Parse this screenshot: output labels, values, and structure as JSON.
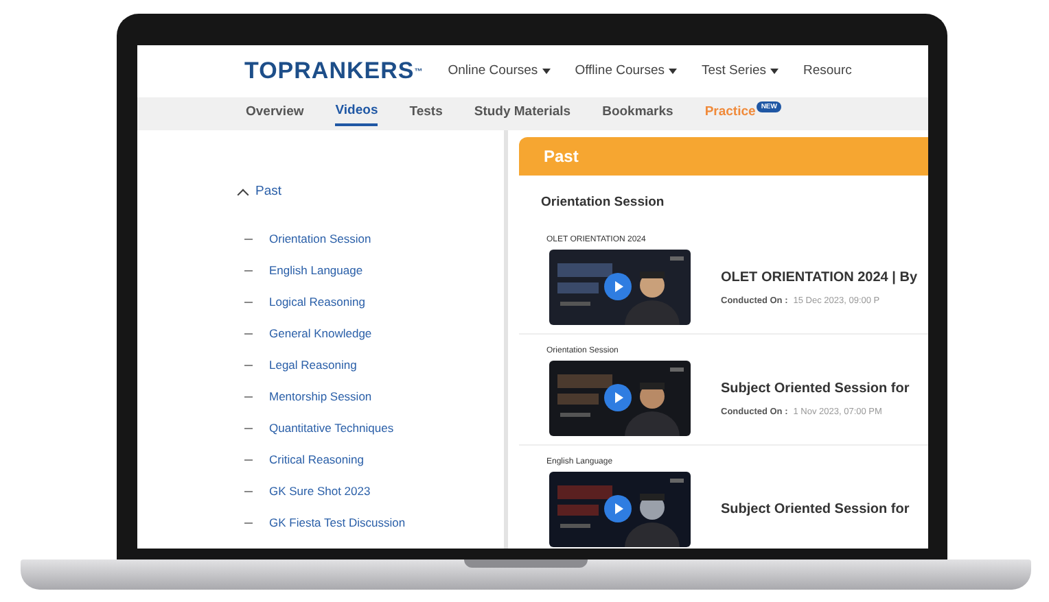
{
  "logo": {
    "text": "TOPRANKERS",
    "mark": "™"
  },
  "top_nav": [
    {
      "label": "Online Courses",
      "dropdown": true
    },
    {
      "label": "Offline Courses",
      "dropdown": true
    },
    {
      "label": "Test Series",
      "dropdown": true
    },
    {
      "label": "Resourc",
      "dropdown": false
    }
  ],
  "tabs": [
    {
      "label": "Overview",
      "selected": false
    },
    {
      "label": "Videos",
      "selected": true
    },
    {
      "label": "Tests",
      "selected": false
    },
    {
      "label": "Study Materials",
      "selected": false
    },
    {
      "label": "Bookmarks",
      "selected": false
    },
    {
      "label": "Practice",
      "selected": false,
      "badge": "NEW"
    }
  ],
  "sidebar": {
    "group": "Past",
    "expanded": true,
    "items": [
      "Orientation Session",
      "English Language",
      "Logical Reasoning",
      "General Knowledge",
      "Legal Reasoning",
      "Mentorship Session",
      "Quantitative Techniques",
      "Critical Reasoning",
      "GK Sure Shot 2023",
      "GK Fiesta Test Discussion"
    ]
  },
  "main": {
    "header": "Past",
    "section": "Orientation Session",
    "videos": [
      {
        "label": "OLET ORIENTATION 2024",
        "title": "OLET ORIENTATION 2024 | By",
        "conducted_label": "Conducted On :",
        "date": "15 Dec 2023, 09:00 P"
      },
      {
        "label": "Orientation Session",
        "title": "Subject Oriented Session for",
        "conducted_label": "Conducted On :",
        "date": "1 Nov 2023, 07:00 PM"
      },
      {
        "label": "English Language",
        "title": "Subject Oriented Session for"
      }
    ]
  }
}
